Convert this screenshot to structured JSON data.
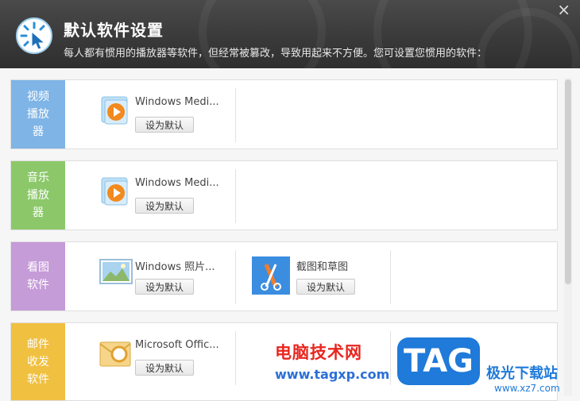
{
  "dialog": {
    "title": "默认软件设置",
    "subtitle": "每人都有惯用的播放器等软件，但经常被篡改，导致用起来不方便。您可设置您惯用的软件：",
    "close_glyph": "×"
  },
  "categories": [
    {
      "label": "视频播放器",
      "color": "#7fb4e6",
      "apps": [
        {
          "name": "Windows Medi...",
          "button": "设为默认",
          "icon": "media-player-icon"
        }
      ]
    },
    {
      "label": "音乐播放器",
      "color": "#8cc86a",
      "apps": [
        {
          "name": "Windows Medi...",
          "button": "设为默认",
          "icon": "media-player-icon"
        }
      ]
    },
    {
      "label": "看图软件",
      "color": "#c59bd8",
      "apps": [
        {
          "name": "Windows 照片...",
          "button": "设为默认",
          "icon": "photo-viewer-icon"
        },
        {
          "name": "截图和草图",
          "button": "设为默认",
          "icon": "snip-sketch-icon"
        }
      ]
    },
    {
      "label": "邮件收发软件",
      "color": "#f0c040",
      "apps": [
        {
          "name": "Microsoft Offic...",
          "button": "设为默认",
          "icon": "outlook-icon"
        }
      ]
    }
  ],
  "watermark": {
    "line1": "电脑技术网",
    "line2": "www.tagxp.com",
    "tag": "TAG",
    "site_name": "极光下载站",
    "site_url": "www.xz7.com"
  }
}
